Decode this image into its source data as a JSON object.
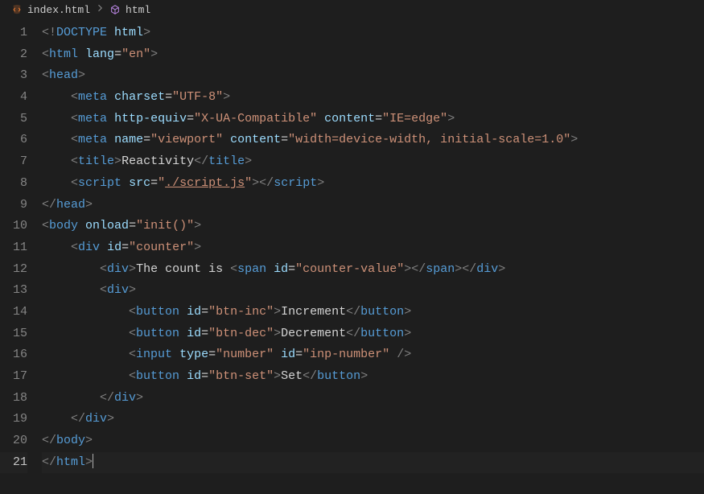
{
  "breadcrumb": {
    "file": "index.html",
    "symbol": "html"
  },
  "lines": [
    {
      "n": 1,
      "indent": 0,
      "tokens": [
        {
          "c": "t-punct",
          "t": "<!"
        },
        {
          "c": "t-doctype",
          "t": "DOCTYPE"
        },
        {
          "c": "t-text",
          "t": " "
        },
        {
          "c": "t-attr",
          "t": "html"
        },
        {
          "c": "t-punct",
          "t": ">"
        }
      ]
    },
    {
      "n": 2,
      "indent": 0,
      "tokens": [
        {
          "c": "t-punct",
          "t": "<"
        },
        {
          "c": "t-tag",
          "t": "html"
        },
        {
          "c": "t-text",
          "t": " "
        },
        {
          "c": "t-attr",
          "t": "lang"
        },
        {
          "c": "t-text",
          "t": "="
        },
        {
          "c": "t-string",
          "t": "\"en\""
        },
        {
          "c": "t-punct",
          "t": ">"
        }
      ]
    },
    {
      "n": 3,
      "indent": 0,
      "tokens": [
        {
          "c": "t-punct",
          "t": "<"
        },
        {
          "c": "t-tag",
          "t": "head"
        },
        {
          "c": "t-punct",
          "t": ">"
        }
      ]
    },
    {
      "n": 4,
      "indent": 1,
      "tokens": [
        {
          "c": "t-punct",
          "t": "<"
        },
        {
          "c": "t-tag",
          "t": "meta"
        },
        {
          "c": "t-text",
          "t": " "
        },
        {
          "c": "t-attr",
          "t": "charset"
        },
        {
          "c": "t-text",
          "t": "="
        },
        {
          "c": "t-string",
          "t": "\"UTF-8\""
        },
        {
          "c": "t-punct",
          "t": ">"
        }
      ]
    },
    {
      "n": 5,
      "indent": 1,
      "tokens": [
        {
          "c": "t-punct",
          "t": "<"
        },
        {
          "c": "t-tag",
          "t": "meta"
        },
        {
          "c": "t-text",
          "t": " "
        },
        {
          "c": "t-attr",
          "t": "http-equiv"
        },
        {
          "c": "t-text",
          "t": "="
        },
        {
          "c": "t-string",
          "t": "\"X-UA-Compatible\""
        },
        {
          "c": "t-text",
          "t": " "
        },
        {
          "c": "t-attr",
          "t": "content"
        },
        {
          "c": "t-text",
          "t": "="
        },
        {
          "c": "t-string",
          "t": "\"IE=edge\""
        },
        {
          "c": "t-punct",
          "t": ">"
        }
      ]
    },
    {
      "n": 6,
      "indent": 1,
      "tokens": [
        {
          "c": "t-punct",
          "t": "<"
        },
        {
          "c": "t-tag",
          "t": "meta"
        },
        {
          "c": "t-text",
          "t": " "
        },
        {
          "c": "t-attr",
          "t": "name"
        },
        {
          "c": "t-text",
          "t": "="
        },
        {
          "c": "t-string",
          "t": "\"viewport\""
        },
        {
          "c": "t-text",
          "t": " "
        },
        {
          "c": "t-attr",
          "t": "content"
        },
        {
          "c": "t-text",
          "t": "="
        },
        {
          "c": "t-string",
          "t": "\"width=device-width, initial-scale=1.0\""
        },
        {
          "c": "t-punct",
          "t": ">"
        }
      ]
    },
    {
      "n": 7,
      "indent": 1,
      "tokens": [
        {
          "c": "t-punct",
          "t": "<"
        },
        {
          "c": "t-tag",
          "t": "title"
        },
        {
          "c": "t-punct",
          "t": ">"
        },
        {
          "c": "t-text",
          "t": "Reactivity"
        },
        {
          "c": "t-punct",
          "t": "</"
        },
        {
          "c": "t-tag",
          "t": "title"
        },
        {
          "c": "t-punct",
          "t": ">"
        }
      ]
    },
    {
      "n": 8,
      "indent": 1,
      "tokens": [
        {
          "c": "t-punct",
          "t": "<"
        },
        {
          "c": "t-tag",
          "t": "script"
        },
        {
          "c": "t-text",
          "t": " "
        },
        {
          "c": "t-attr",
          "t": "src"
        },
        {
          "c": "t-text",
          "t": "="
        },
        {
          "c": "t-string",
          "t": "\""
        },
        {
          "c": "t-link",
          "t": "./script.js"
        },
        {
          "c": "t-string",
          "t": "\""
        },
        {
          "c": "t-punct",
          "t": ">"
        },
        {
          "c": "t-punct",
          "t": "</"
        },
        {
          "c": "t-tag",
          "t": "script"
        },
        {
          "c": "t-punct",
          "t": ">"
        }
      ]
    },
    {
      "n": 9,
      "indent": 0,
      "tokens": [
        {
          "c": "t-punct",
          "t": "</"
        },
        {
          "c": "t-tag",
          "t": "head"
        },
        {
          "c": "t-punct",
          "t": ">"
        }
      ]
    },
    {
      "n": 10,
      "indent": 0,
      "tokens": [
        {
          "c": "t-punct",
          "t": "<"
        },
        {
          "c": "t-tag",
          "t": "body"
        },
        {
          "c": "t-text",
          "t": " "
        },
        {
          "c": "t-attr",
          "t": "onload"
        },
        {
          "c": "t-text",
          "t": "="
        },
        {
          "c": "t-string",
          "t": "\"init()\""
        },
        {
          "c": "t-punct",
          "t": ">"
        }
      ]
    },
    {
      "n": 11,
      "indent": 1,
      "tokens": [
        {
          "c": "t-punct",
          "t": "<"
        },
        {
          "c": "t-tag",
          "t": "div"
        },
        {
          "c": "t-text",
          "t": " "
        },
        {
          "c": "t-attr",
          "t": "id"
        },
        {
          "c": "t-text",
          "t": "="
        },
        {
          "c": "t-string",
          "t": "\"counter\""
        },
        {
          "c": "t-punct",
          "t": ">"
        }
      ]
    },
    {
      "n": 12,
      "indent": 2,
      "tokens": [
        {
          "c": "t-punct",
          "t": "<"
        },
        {
          "c": "t-tag",
          "t": "div"
        },
        {
          "c": "t-punct",
          "t": ">"
        },
        {
          "c": "t-text",
          "t": "The count is "
        },
        {
          "c": "t-punct",
          "t": "<"
        },
        {
          "c": "t-tag",
          "t": "span"
        },
        {
          "c": "t-text",
          "t": " "
        },
        {
          "c": "t-attr",
          "t": "id"
        },
        {
          "c": "t-text",
          "t": "="
        },
        {
          "c": "t-string",
          "t": "\"counter-value\""
        },
        {
          "c": "t-punct",
          "t": ">"
        },
        {
          "c": "t-punct",
          "t": "</"
        },
        {
          "c": "t-tag",
          "t": "span"
        },
        {
          "c": "t-punct",
          "t": ">"
        },
        {
          "c": "t-punct",
          "t": "</"
        },
        {
          "c": "t-tag",
          "t": "div"
        },
        {
          "c": "t-punct",
          "t": ">"
        }
      ]
    },
    {
      "n": 13,
      "indent": 2,
      "tokens": [
        {
          "c": "t-punct",
          "t": "<"
        },
        {
          "c": "t-tag",
          "t": "div"
        },
        {
          "c": "t-punct",
          "t": ">"
        }
      ]
    },
    {
      "n": 14,
      "indent": 3,
      "tokens": [
        {
          "c": "t-punct",
          "t": "<"
        },
        {
          "c": "t-tag",
          "t": "button"
        },
        {
          "c": "t-text",
          "t": " "
        },
        {
          "c": "t-attr",
          "t": "id"
        },
        {
          "c": "t-text",
          "t": "="
        },
        {
          "c": "t-string",
          "t": "\"btn-inc\""
        },
        {
          "c": "t-punct",
          "t": ">"
        },
        {
          "c": "t-text",
          "t": "Increment"
        },
        {
          "c": "t-punct",
          "t": "</"
        },
        {
          "c": "t-tag",
          "t": "button"
        },
        {
          "c": "t-punct",
          "t": ">"
        }
      ]
    },
    {
      "n": 15,
      "indent": 3,
      "tokens": [
        {
          "c": "t-punct",
          "t": "<"
        },
        {
          "c": "t-tag",
          "t": "button"
        },
        {
          "c": "t-text",
          "t": " "
        },
        {
          "c": "t-attr",
          "t": "id"
        },
        {
          "c": "t-text",
          "t": "="
        },
        {
          "c": "t-string",
          "t": "\"btn-dec\""
        },
        {
          "c": "t-punct",
          "t": ">"
        },
        {
          "c": "t-text",
          "t": "Decrement"
        },
        {
          "c": "t-punct",
          "t": "</"
        },
        {
          "c": "t-tag",
          "t": "button"
        },
        {
          "c": "t-punct",
          "t": ">"
        }
      ]
    },
    {
      "n": 16,
      "indent": 3,
      "tokens": [
        {
          "c": "t-punct",
          "t": "<"
        },
        {
          "c": "t-tag",
          "t": "input"
        },
        {
          "c": "t-text",
          "t": " "
        },
        {
          "c": "t-attr",
          "t": "type"
        },
        {
          "c": "t-text",
          "t": "="
        },
        {
          "c": "t-string",
          "t": "\"number\""
        },
        {
          "c": "t-text",
          "t": " "
        },
        {
          "c": "t-attr",
          "t": "id"
        },
        {
          "c": "t-text",
          "t": "="
        },
        {
          "c": "t-string",
          "t": "\"inp-number\""
        },
        {
          "c": "t-text",
          "t": " "
        },
        {
          "c": "t-punct",
          "t": "/>"
        }
      ]
    },
    {
      "n": 17,
      "indent": 3,
      "tokens": [
        {
          "c": "t-punct",
          "t": "<"
        },
        {
          "c": "t-tag",
          "t": "button"
        },
        {
          "c": "t-text",
          "t": " "
        },
        {
          "c": "t-attr",
          "t": "id"
        },
        {
          "c": "t-text",
          "t": "="
        },
        {
          "c": "t-string",
          "t": "\"btn-set\""
        },
        {
          "c": "t-punct",
          "t": ">"
        },
        {
          "c": "t-text",
          "t": "Set"
        },
        {
          "c": "t-punct",
          "t": "</"
        },
        {
          "c": "t-tag",
          "t": "button"
        },
        {
          "c": "t-punct",
          "t": ">"
        }
      ]
    },
    {
      "n": 18,
      "indent": 2,
      "tokens": [
        {
          "c": "t-punct",
          "t": "</"
        },
        {
          "c": "t-tag",
          "t": "div"
        },
        {
          "c": "t-punct",
          "t": ">"
        }
      ]
    },
    {
      "n": 19,
      "indent": 1,
      "tokens": [
        {
          "c": "t-punct",
          "t": "</"
        },
        {
          "c": "t-tag",
          "t": "div"
        },
        {
          "c": "t-punct",
          "t": ">"
        }
      ]
    },
    {
      "n": 20,
      "indent": 0,
      "tokens": [
        {
          "c": "t-punct",
          "t": "</"
        },
        {
          "c": "t-tag",
          "t": "body"
        },
        {
          "c": "t-punct",
          "t": ">"
        }
      ]
    },
    {
      "n": 21,
      "indent": 0,
      "current": true,
      "tokens": [
        {
          "c": "t-punct",
          "t": "</"
        },
        {
          "c": "t-tag",
          "t": "html"
        },
        {
          "c": "t-punct",
          "t": ">"
        }
      ]
    }
  ]
}
